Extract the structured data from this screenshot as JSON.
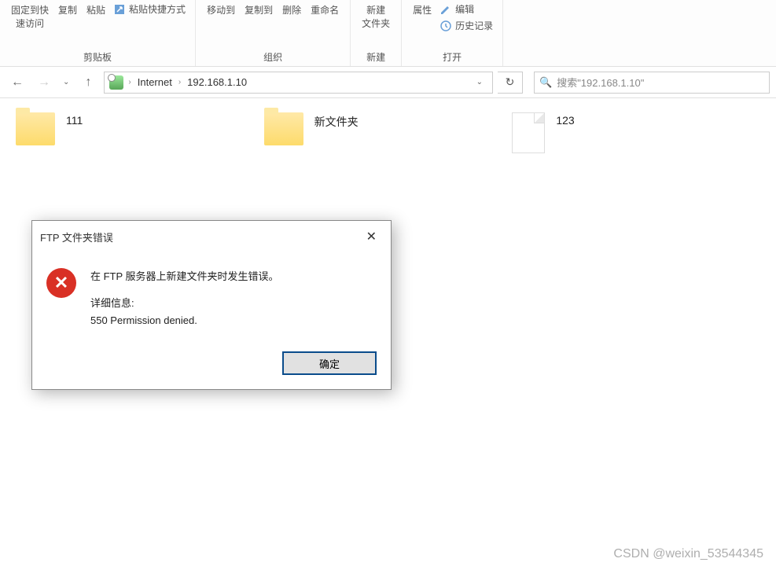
{
  "ribbon": {
    "pin_to_quick": "固定到快\n速访问",
    "copy": "复制",
    "paste": "粘贴",
    "paste_shortcut": "粘贴快捷方式",
    "clipboard_label": "剪贴板",
    "move_to": "移动到",
    "copy_to": "复制到",
    "delete": "删除",
    "rename": "重命名",
    "organize_label": "组织",
    "new_folder": "新建\n文件夹",
    "new_label": "新建",
    "properties": "属性",
    "edit": "编辑",
    "history": "历史记录",
    "open_label": "打开"
  },
  "breadcrumb": {
    "item1": "Internet",
    "item2": "192.168.1.10"
  },
  "search": {
    "placeholder": "搜索\"192.168.1.10\""
  },
  "files": [
    {
      "name": "111",
      "type": "folder"
    },
    {
      "name": "新文件夹",
      "type": "folder"
    },
    {
      "name": "123",
      "type": "file"
    }
  ],
  "dialog": {
    "title": "FTP 文件夹错误",
    "message": "在 FTP 服务器上新建文件夹时发生错误。",
    "details_label": "详细信息:",
    "details_text": "550 Permission denied.",
    "ok": "确定"
  },
  "watermark": "CSDN @weixin_53544345"
}
